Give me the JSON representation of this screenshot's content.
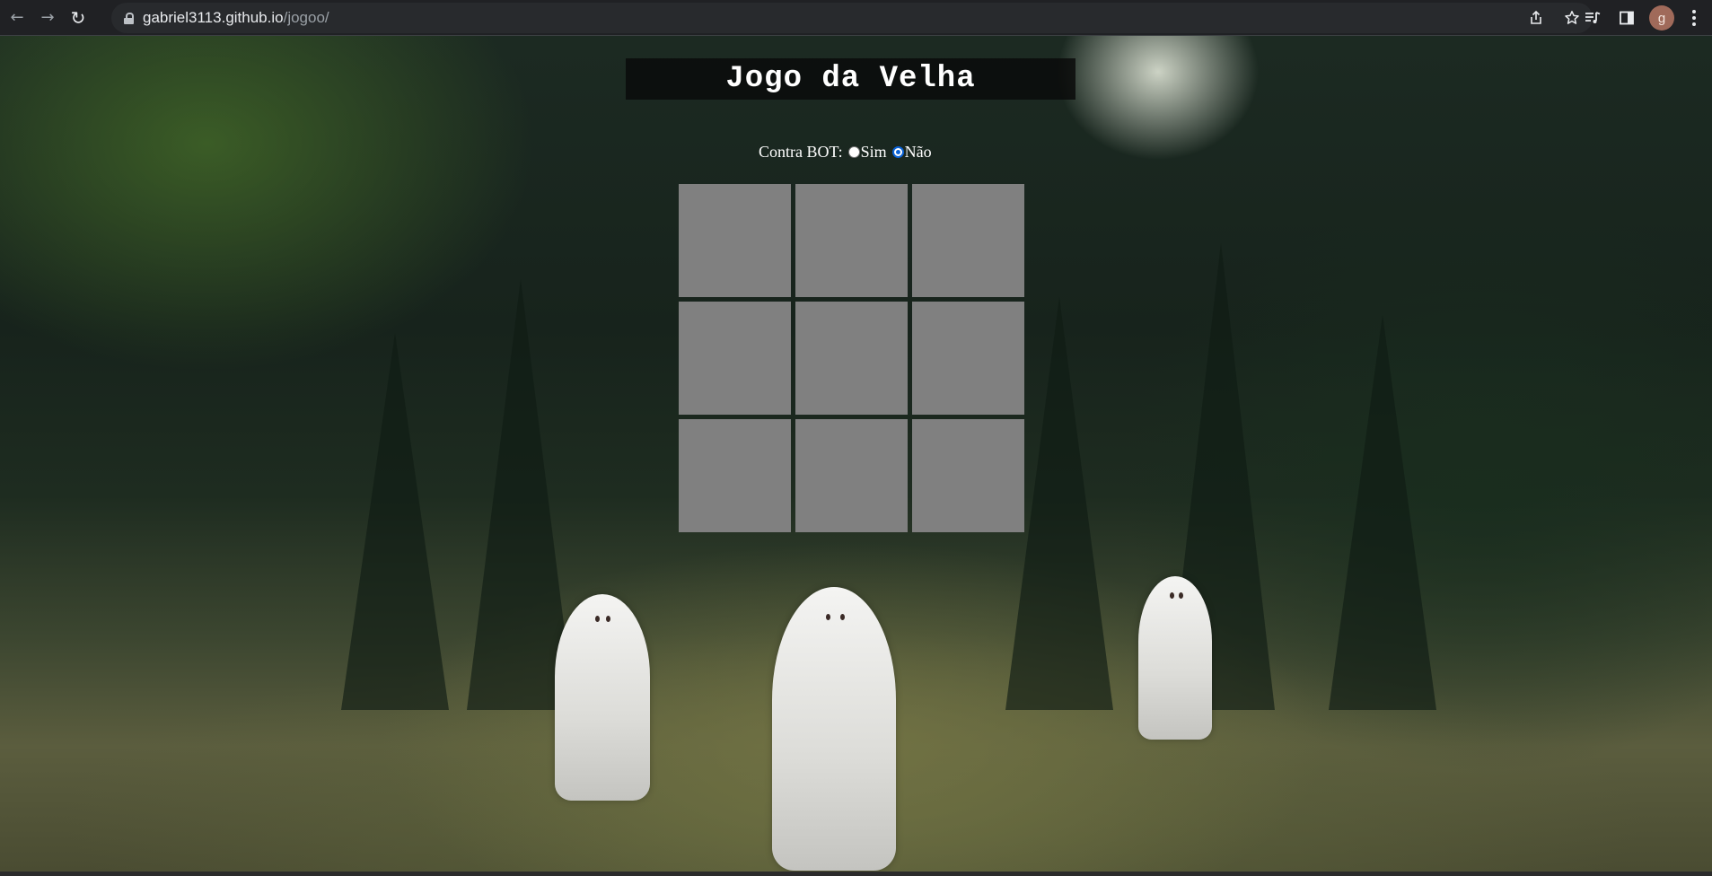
{
  "browser": {
    "url_host": "gabriel3113.github.io",
    "url_path": "/jogoo/",
    "back_icon": "arrow-left-icon",
    "forward_icon": "arrow-right-icon",
    "reload_icon": "reload-icon",
    "share_icon": "share-icon",
    "bookmark_icon": "star-icon",
    "media_icon": "media-queue-icon",
    "sidepanel_icon": "side-panel-icon",
    "profile_initial": "g",
    "menu_icon": "kebab-menu-icon"
  },
  "page": {
    "title": "Jogo da Velha",
    "bot_label": "Contra BOT:",
    "options": [
      {
        "label": "Sim",
        "checked": false
      },
      {
        "label": "Não",
        "checked": true
      }
    ],
    "board": {
      "rows": 3,
      "cols": 3,
      "cells": [
        "",
        "",
        "",
        "",
        "",
        "",
        "",
        "",
        ""
      ],
      "cell_color": "#808080"
    }
  },
  "colors": {
    "chrome_bg": "#202124",
    "omnibox_bg": "#282a2d",
    "radio_accent": "#0b63d8",
    "title_bar_bg": "#0a0a0a"
  }
}
